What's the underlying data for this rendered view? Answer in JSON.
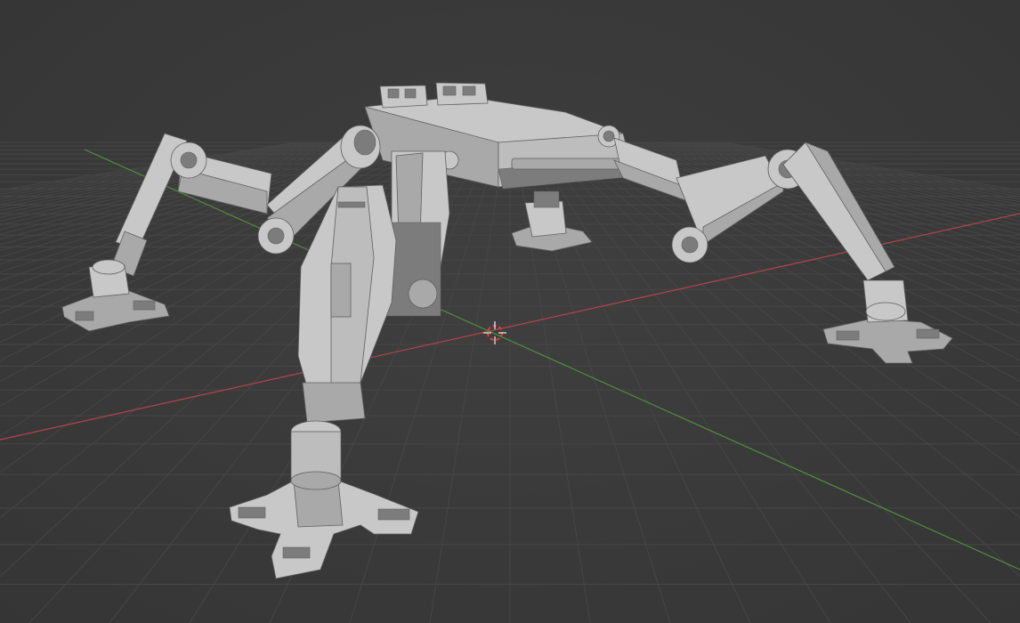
{
  "app": {
    "view": "3D Viewport",
    "colors": {
      "background": "#3a3a3a",
      "grid_line": "#464646",
      "x_axis": "#b34646",
      "y_axis": "#4f8f3a",
      "model_light": "#c8c8c8",
      "model_mid": "#a9a9a9",
      "model_dark": "#7c7c7c",
      "model_shadow": "#5f5f5f",
      "cursor_red": "#e23c3c",
      "cursor_white": "#f0f0f0"
    }
  },
  "scene": {
    "object": "quadruped-mech-model",
    "grid": true,
    "axes_shown": [
      "x",
      "y"
    ],
    "cursor": "3d-cursor"
  }
}
